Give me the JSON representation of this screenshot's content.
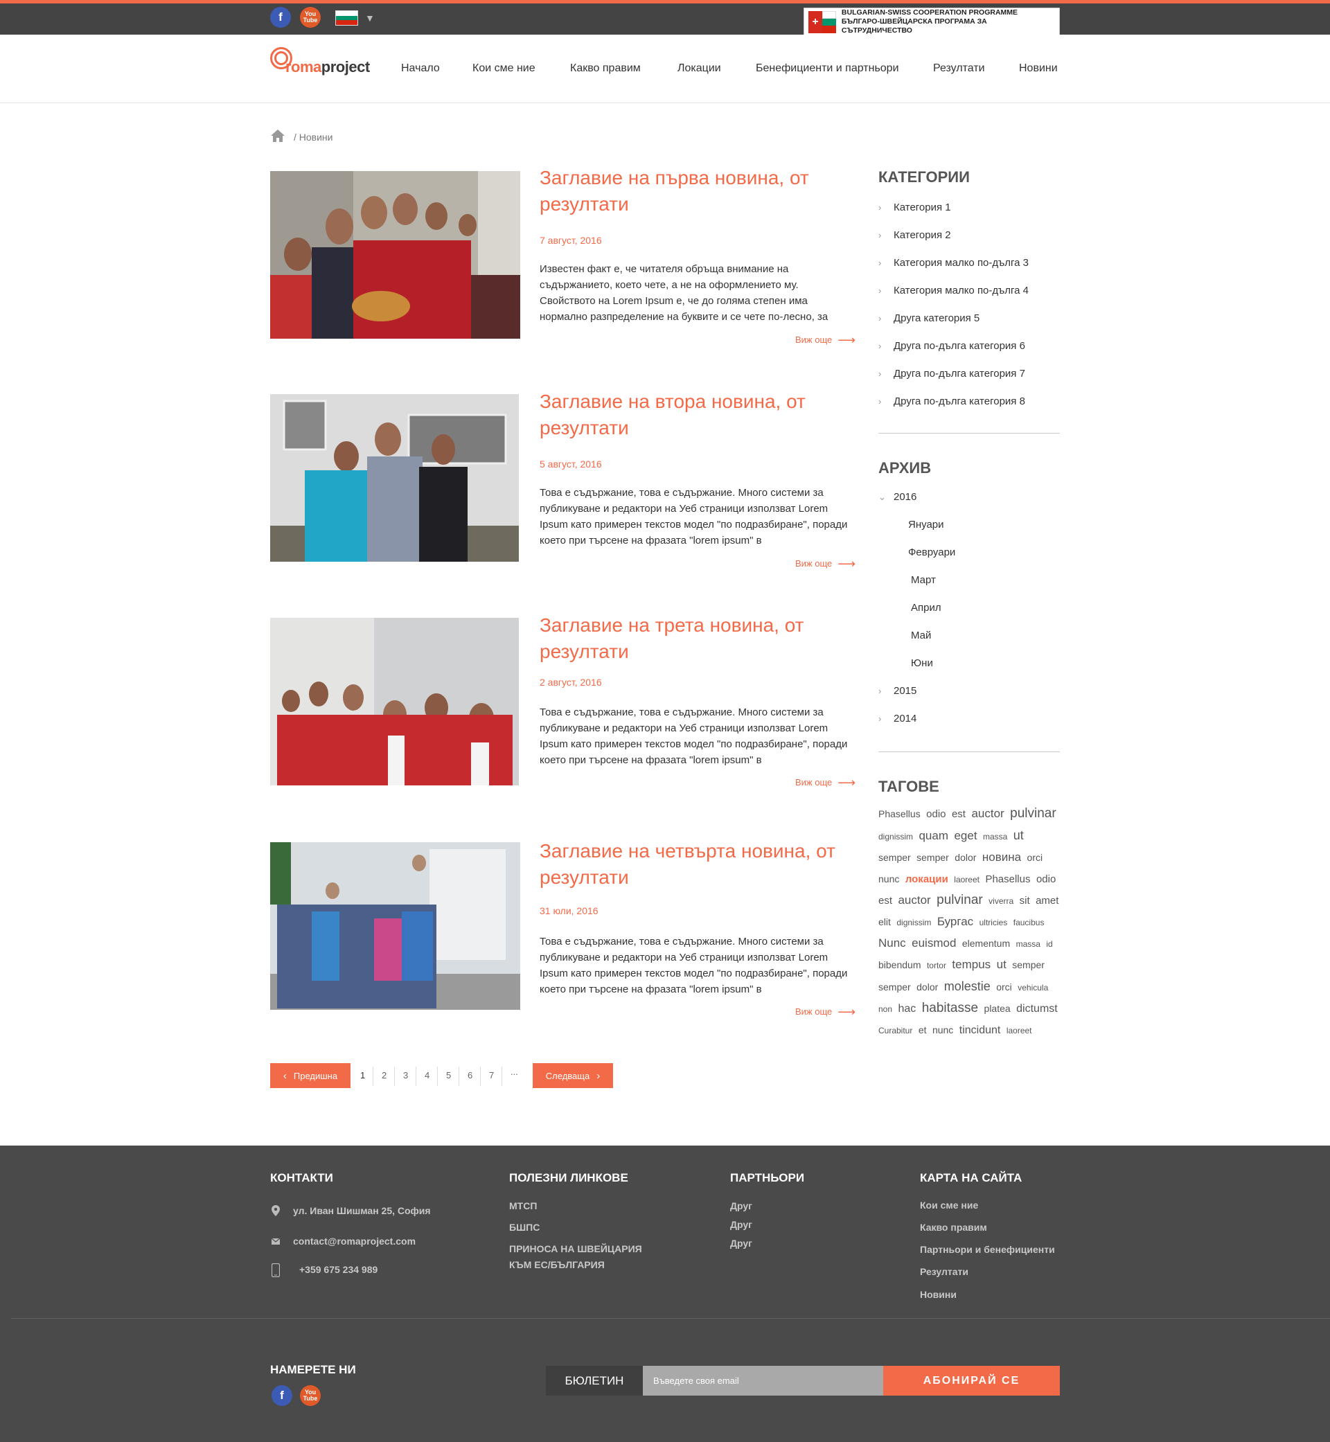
{
  "topbar": {
    "facebook_glyph": "f",
    "youtube_glyph": "You Tube",
    "flag_colors": [
      "#ffffff",
      "#00966e",
      "#d62612"
    ],
    "accent": "#f26a48",
    "coop_line1": "BULGARIAN-SWISS COOPERATION PROGRAMME",
    "coop_line2": "БЪЛГАРО-ШВЕЙЦАРСКА ПРОГРАМА ЗА СЪТРУДНИЧЕСТВО"
  },
  "header": {
    "logo_roma": "roma",
    "logo_project": "project",
    "nav": [
      "Начало",
      "Кои сме ние",
      "Какво правим",
      "Локации",
      "Бенефициенти и партньори",
      "Резултати",
      "Новини"
    ]
  },
  "breadcrumb": {
    "current": "/  Новини"
  },
  "articles": [
    {
      "title": "Заглавие на първа новина, от резултати",
      "date": "7 август, 2016",
      "text": "Известен факт е, че читателя обръща внимание на съдържанието, което чете, а не на оформлението му. Свойството на Lorem Ipsum е, че до голяма степен има нормално разпределение на буквите и се чете по-лесно, за",
      "more": "Виж още"
    },
    {
      "title": "Заглавие на втора новина, от резултати",
      "date": "5 август, 2016",
      "text": "Това е съдържание, това е съдържание. Много системи за публикуване и редактори на Уеб страници използват Lorem Ipsum като примерен текстов модел \"по подразбиране\", поради което при търсене на фразата \"lorem ipsum\" в",
      "more": "Виж още"
    },
    {
      "title": "Заглавие на трета новина, от резултати",
      "date": "2 август, 2016",
      "text": "Това е съдържание, това е съдържание. Много системи за публикуване и редактори на Уеб страници използват Lorem Ipsum като примерен текстов модел \"по подразбиране\", поради което при търсене на фразата \"lorem ipsum\" в",
      "more": "Виж още"
    },
    {
      "title": "Заглавие на четвърта новина, от резултати",
      "date": "31 юли, 2016",
      "text": "Това е съдържание, това е съдържание. Много системи за публикуване и редактори на Уеб страници използват Lorem Ipsum като примерен текстов модел \"по подразбиране\", поради което при търсене на фразата \"lorem ipsum\" в",
      "more": "Виж още"
    }
  ],
  "sidebar": {
    "categories_title": "КАТЕГОРИИ",
    "categories": [
      "Категория 1",
      "Категория 2",
      "Категория малко по-дълга 3",
      "Категория малко по-дълга 4",
      "Друга категория 5",
      "Друга по-дълга категория 6",
      "Друга по-дълга категория 7",
      "Друга по-дълга категория 8"
    ],
    "archive_title": "АРХИВ",
    "archive_year_open": "2016",
    "archive_months": [
      "Януари",
      "Февруари",
      "Март",
      "Април",
      "Май",
      "Юни"
    ],
    "archive_years_closed": [
      "2015",
      "2014"
    ],
    "tags_title": "ТАГОВЕ",
    "tags": [
      {
        "t": "Phasellus",
        "s": 14
      },
      {
        "t": "odio",
        "s": 15
      },
      {
        "t": "est",
        "s": 15
      },
      {
        "t": "auctor",
        "s": 17
      },
      {
        "t": "pulvinar",
        "s": 19
      },
      {
        "t": "dignissim",
        "s": 12
      },
      {
        "t": "quam",
        "s": 17
      },
      {
        "t": "eget",
        "s": 17
      },
      {
        "t": "massa",
        "s": 12
      },
      {
        "t": "ut",
        "s": 18
      },
      {
        "t": "semper",
        "s": 14
      },
      {
        "t": "semper",
        "s": 14
      },
      {
        "t": "dolor",
        "s": 14
      },
      {
        "t": "новина",
        "s": 17
      },
      {
        "t": "orci",
        "s": 14
      },
      {
        "t": "nunc",
        "s": 14
      },
      {
        "t": "локации",
        "s": 15,
        "accent": true
      },
      {
        "t": "laoreet",
        "s": 12
      },
      {
        "t": "Phasellus",
        "s": 15
      },
      {
        "t": "odio",
        "s": 15
      },
      {
        "t": "est",
        "s": 15
      },
      {
        "t": "auctor",
        "s": 17
      },
      {
        "t": "pulvinar",
        "s": 19
      },
      {
        "t": "viverra",
        "s": 12
      },
      {
        "t": "sit",
        "s": 15
      },
      {
        "t": "amet",
        "s": 15
      },
      {
        "t": "elit",
        "s": 14
      },
      {
        "t": "dignissim",
        "s": 12
      },
      {
        "t": "Бургас",
        "s": 17
      },
      {
        "t": "ultricies",
        "s": 12
      },
      {
        "t": "faucibus",
        "s": 12
      },
      {
        "t": "Nunc",
        "s": 17
      },
      {
        "t": "euismod",
        "s": 17
      },
      {
        "t": "elementum",
        "s": 14
      },
      {
        "t": "massa",
        "s": 12
      },
      {
        "t": "id",
        "s": 12
      },
      {
        "t": "bibendum",
        "s": 14
      },
      {
        "t": "tortor",
        "s": 12
      },
      {
        "t": "tempus",
        "s": 17
      },
      {
        "t": "ut",
        "s": 17
      },
      {
        "t": "semper",
        "s": 14
      },
      {
        "t": "semper",
        "s": 14
      },
      {
        "t": "dolor",
        "s": 14
      },
      {
        "t": "molestie",
        "s": 18
      },
      {
        "t": "orci",
        "s": 14
      },
      {
        "t": "vehicula",
        "s": 12
      },
      {
        "t": "non",
        "s": 12
      },
      {
        "t": "hac",
        "s": 16
      },
      {
        "t": "habitasse",
        "s": 19
      },
      {
        "t": "platea",
        "s": 14
      },
      {
        "t": "dictumst",
        "s": 16
      },
      {
        "t": "Curabitur",
        "s": 12
      },
      {
        "t": "et",
        "s": 14
      },
      {
        "t": "nunc",
        "s": 14
      },
      {
        "t": "tincidunt",
        "s": 16
      },
      {
        "t": "laoreet",
        "s": 12
      }
    ]
  },
  "pagination": {
    "prev": "Предишна",
    "next": "Следваща",
    "pages": [
      "1",
      "2",
      "3",
      "4",
      "5",
      "6",
      "7",
      "..."
    ]
  },
  "footer": {
    "contacts_title": "КОНТАКТИ",
    "address": "ул. Иван Шишман 25, София",
    "email": "contact@romaproject.com",
    "phone": "+359 675 234 989",
    "links_title": "ПОЛЕЗНИ ЛИНКОВЕ",
    "links": [
      "МТСП",
      "БШПС",
      "ПРИНОСА НА ШВЕЙЦАРИЯ",
      "КЪМ ЕС/БЪЛГАРИЯ"
    ],
    "partners_title": "ПАРТНЬОРИ",
    "partners": [
      "Друг",
      "Друг",
      "Друг"
    ],
    "sitemap_title": "КАРТА НА САЙТА",
    "sitemap": [
      "Кои сме ние",
      "Какво правим",
      "Партньори и бенефициенти",
      "Резултати",
      "Новини"
    ],
    "find_us": "НАМЕРЕТЕ НИ",
    "newsletter_label": "БЮЛЕТИН",
    "newsletter_placeholder": "Въведете своя email",
    "subscribe": "АБОНИРАЙ СЕ"
  }
}
